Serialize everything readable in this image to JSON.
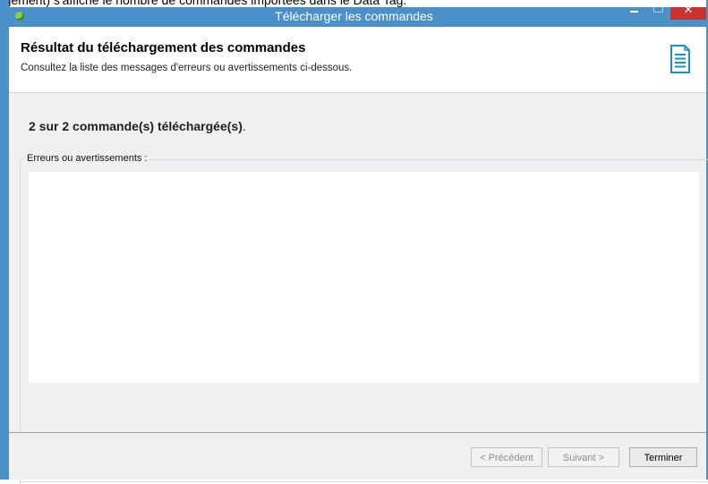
{
  "document": {
    "caption_fragment": "rgement) s'affiche le nombre de commandes importées dans le Data Tag."
  },
  "window": {
    "title": "Télécharger les commandes",
    "controls": {
      "minimize_icon": "minimize-icon",
      "maximize_icon": "maximize-icon",
      "close_glyph": "✕"
    },
    "frame_color": "#4a90c9",
    "close_color": "#c7332f"
  },
  "header": {
    "title": "Résultat du téléchargement des commandes",
    "subtitle": "Consultez la liste des messages d'erreurs ou avertissements ci-dessous.",
    "icon": "document-list-icon"
  },
  "main": {
    "status": "2 sur 2 commande(s) téléchargée(s)",
    "status_suffix": ".",
    "messages_group_label": "Erreurs ou avertissements :",
    "messages": []
  },
  "footer": {
    "previous_label": "< Précédent",
    "next_label": "Suivant >",
    "finish_label": "Terminer"
  }
}
